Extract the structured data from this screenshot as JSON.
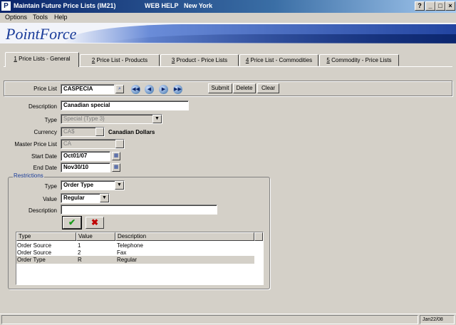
{
  "window": {
    "title": "Maintain Future Price Lists (IM21)",
    "help": "WEB HELP",
    "city": "New York",
    "buttons": {
      "help": "?",
      "minimize": "_",
      "maximize": "□",
      "close": "×"
    }
  },
  "menu": {
    "items": [
      {
        "label": "Options"
      },
      {
        "label": "Tools"
      },
      {
        "label": "Help"
      }
    ]
  },
  "banner": {
    "logo": "PointForce"
  },
  "tabs": [
    {
      "num": "1",
      "label": " Price Lists - General"
    },
    {
      "num": "2",
      "label": " Price List - Products"
    },
    {
      "num": "3",
      "label": " Product - Price Lists"
    },
    {
      "num": "4",
      "label": " Price List - Commodities"
    },
    {
      "num": "5",
      "label": " Commodity - Price Lists"
    }
  ],
  "header": {
    "price_list_label": "Price List",
    "price_list_value": "CASPECIA",
    "lookup_icon": "magnifier-icon",
    "nav": {
      "first": "◀◀",
      "prev": "◀",
      "next": "▶",
      "last": "▶▶"
    },
    "submit_label": "Submit",
    "delete_label": "Delete",
    "clear_label": "Clear"
  },
  "form": {
    "description_label": "Description",
    "description_value": "Canadian special",
    "type_label": "Type",
    "type_value": "Special  {Type 3}",
    "currency_label": "Currency",
    "currency_value": "CA$",
    "currency_name": "Canadian Dollars",
    "master_label": "Master Price List",
    "master_value": "CA",
    "start_label": "Start Date",
    "start_value": "Oct01/07",
    "end_label": "End Date",
    "end_value": "Nov30/10"
  },
  "restrictions": {
    "legend": "Restrictions",
    "type_label": "Type",
    "type_value": "Order Type",
    "value_label": "Value",
    "value_value": "Regular",
    "description_label": "Description",
    "description_value": "",
    "ok_icon": "checkmark-icon",
    "cancel_icon": "x-icon",
    "columns": [
      "Type",
      "Value",
      "Description"
    ],
    "rows": [
      {
        "type": "Order Source",
        "value": "1",
        "description": "Telephone"
      },
      {
        "type": "Order Source",
        "value": "2",
        "description": "Fax"
      },
      {
        "type": "Order Type",
        "value": "R",
        "description": "Regular"
      }
    ]
  },
  "status": {
    "date": "Jan22/08"
  }
}
